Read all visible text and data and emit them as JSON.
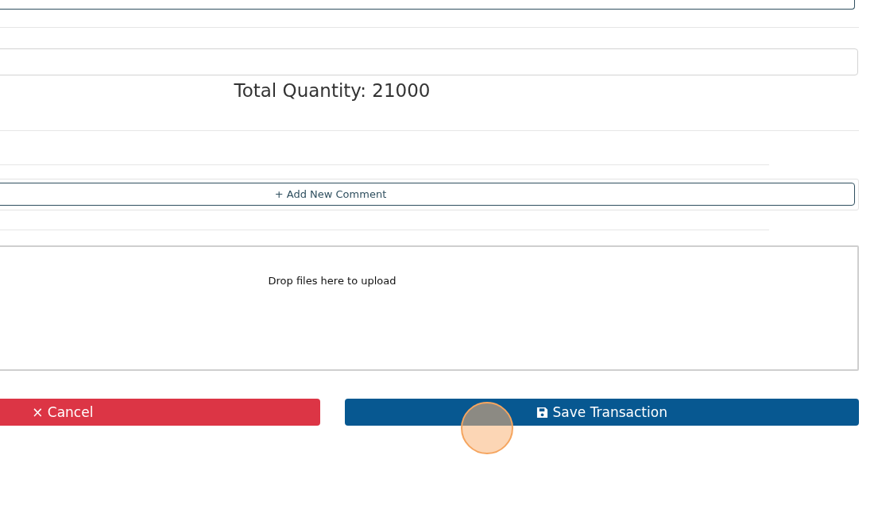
{
  "total_quantity": "Total Quantity: 21000",
  "add_comment_button": {
    "icon": "+",
    "label": "Add New Comment"
  },
  "dropzone": {
    "message": "Drop files here to upload"
  },
  "buttons": [
    {
      "kind": "cancel",
      "icon": "×",
      "label": "Cancel"
    },
    {
      "kind": "save",
      "label": "Save Transaction"
    }
  ]
}
